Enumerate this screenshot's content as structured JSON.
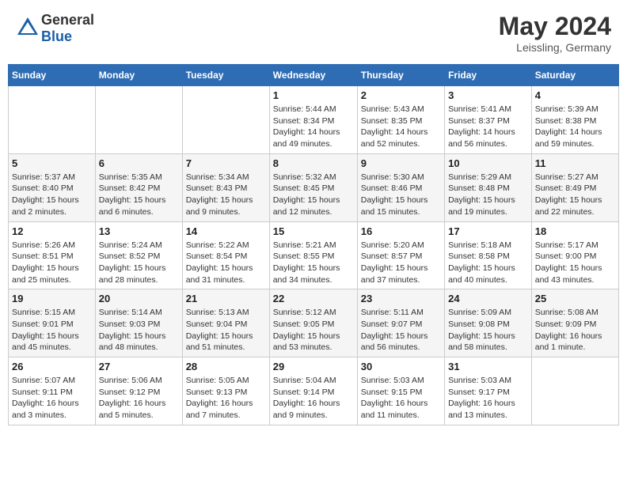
{
  "header": {
    "logo_general": "General",
    "logo_blue": "Blue",
    "month_year": "May 2024",
    "location": "Leissling, Germany"
  },
  "weekdays": [
    "Sunday",
    "Monday",
    "Tuesday",
    "Wednesday",
    "Thursday",
    "Friday",
    "Saturday"
  ],
  "weeks": [
    [
      {
        "day": "",
        "info": ""
      },
      {
        "day": "",
        "info": ""
      },
      {
        "day": "",
        "info": ""
      },
      {
        "day": "1",
        "info": "Sunrise: 5:44 AM\nSunset: 8:34 PM\nDaylight: 14 hours\nand 49 minutes."
      },
      {
        "day": "2",
        "info": "Sunrise: 5:43 AM\nSunset: 8:35 PM\nDaylight: 14 hours\nand 52 minutes."
      },
      {
        "day": "3",
        "info": "Sunrise: 5:41 AM\nSunset: 8:37 PM\nDaylight: 14 hours\nand 56 minutes."
      },
      {
        "day": "4",
        "info": "Sunrise: 5:39 AM\nSunset: 8:38 PM\nDaylight: 14 hours\nand 59 minutes."
      }
    ],
    [
      {
        "day": "5",
        "info": "Sunrise: 5:37 AM\nSunset: 8:40 PM\nDaylight: 15 hours\nand 2 minutes."
      },
      {
        "day": "6",
        "info": "Sunrise: 5:35 AM\nSunset: 8:42 PM\nDaylight: 15 hours\nand 6 minutes."
      },
      {
        "day": "7",
        "info": "Sunrise: 5:34 AM\nSunset: 8:43 PM\nDaylight: 15 hours\nand 9 minutes."
      },
      {
        "day": "8",
        "info": "Sunrise: 5:32 AM\nSunset: 8:45 PM\nDaylight: 15 hours\nand 12 minutes."
      },
      {
        "day": "9",
        "info": "Sunrise: 5:30 AM\nSunset: 8:46 PM\nDaylight: 15 hours\nand 15 minutes."
      },
      {
        "day": "10",
        "info": "Sunrise: 5:29 AM\nSunset: 8:48 PM\nDaylight: 15 hours\nand 19 minutes."
      },
      {
        "day": "11",
        "info": "Sunrise: 5:27 AM\nSunset: 8:49 PM\nDaylight: 15 hours\nand 22 minutes."
      }
    ],
    [
      {
        "day": "12",
        "info": "Sunrise: 5:26 AM\nSunset: 8:51 PM\nDaylight: 15 hours\nand 25 minutes."
      },
      {
        "day": "13",
        "info": "Sunrise: 5:24 AM\nSunset: 8:52 PM\nDaylight: 15 hours\nand 28 minutes."
      },
      {
        "day": "14",
        "info": "Sunrise: 5:22 AM\nSunset: 8:54 PM\nDaylight: 15 hours\nand 31 minutes."
      },
      {
        "day": "15",
        "info": "Sunrise: 5:21 AM\nSunset: 8:55 PM\nDaylight: 15 hours\nand 34 minutes."
      },
      {
        "day": "16",
        "info": "Sunrise: 5:20 AM\nSunset: 8:57 PM\nDaylight: 15 hours\nand 37 minutes."
      },
      {
        "day": "17",
        "info": "Sunrise: 5:18 AM\nSunset: 8:58 PM\nDaylight: 15 hours\nand 40 minutes."
      },
      {
        "day": "18",
        "info": "Sunrise: 5:17 AM\nSunset: 9:00 PM\nDaylight: 15 hours\nand 43 minutes."
      }
    ],
    [
      {
        "day": "19",
        "info": "Sunrise: 5:15 AM\nSunset: 9:01 PM\nDaylight: 15 hours\nand 45 minutes."
      },
      {
        "day": "20",
        "info": "Sunrise: 5:14 AM\nSunset: 9:03 PM\nDaylight: 15 hours\nand 48 minutes."
      },
      {
        "day": "21",
        "info": "Sunrise: 5:13 AM\nSunset: 9:04 PM\nDaylight: 15 hours\nand 51 minutes."
      },
      {
        "day": "22",
        "info": "Sunrise: 5:12 AM\nSunset: 9:05 PM\nDaylight: 15 hours\nand 53 minutes."
      },
      {
        "day": "23",
        "info": "Sunrise: 5:11 AM\nSunset: 9:07 PM\nDaylight: 15 hours\nand 56 minutes."
      },
      {
        "day": "24",
        "info": "Sunrise: 5:09 AM\nSunset: 9:08 PM\nDaylight: 15 hours\nand 58 minutes."
      },
      {
        "day": "25",
        "info": "Sunrise: 5:08 AM\nSunset: 9:09 PM\nDaylight: 16 hours\nand 1 minute."
      }
    ],
    [
      {
        "day": "26",
        "info": "Sunrise: 5:07 AM\nSunset: 9:11 PM\nDaylight: 16 hours\nand 3 minutes."
      },
      {
        "day": "27",
        "info": "Sunrise: 5:06 AM\nSunset: 9:12 PM\nDaylight: 16 hours\nand 5 minutes."
      },
      {
        "day": "28",
        "info": "Sunrise: 5:05 AM\nSunset: 9:13 PM\nDaylight: 16 hours\nand 7 minutes."
      },
      {
        "day": "29",
        "info": "Sunrise: 5:04 AM\nSunset: 9:14 PM\nDaylight: 16 hours\nand 9 minutes."
      },
      {
        "day": "30",
        "info": "Sunrise: 5:03 AM\nSunset: 9:15 PM\nDaylight: 16 hours\nand 11 minutes."
      },
      {
        "day": "31",
        "info": "Sunrise: 5:03 AM\nSunset: 9:17 PM\nDaylight: 16 hours\nand 13 minutes."
      },
      {
        "day": "",
        "info": ""
      }
    ]
  ]
}
